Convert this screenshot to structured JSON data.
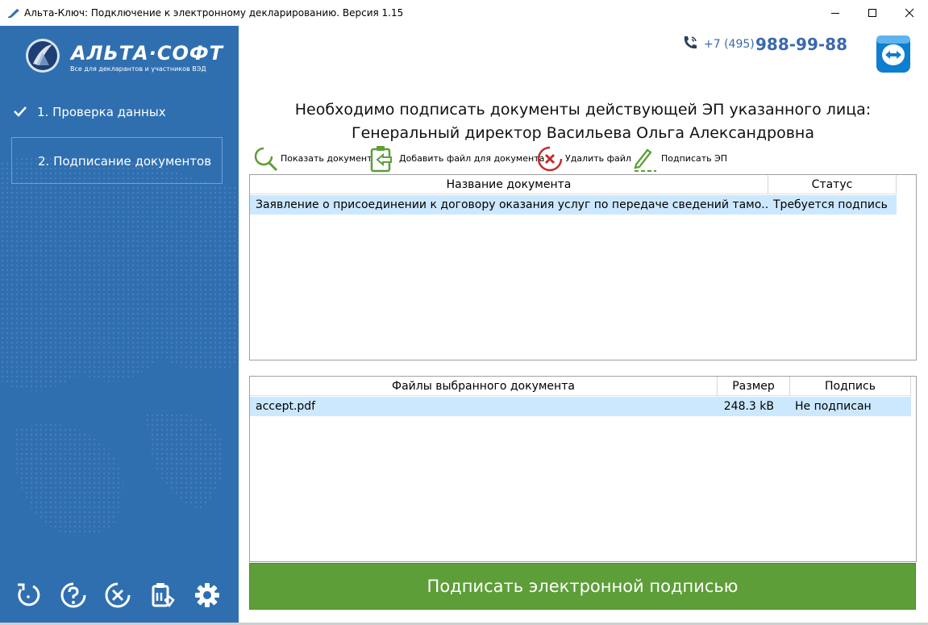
{
  "window": {
    "title": "Альта-Ключ: Подключение к электронному декларированию. Версия 1.15"
  },
  "sidebar": {
    "logo_text": "АЛЬТА·СОФТ",
    "logo_tagline": "Все для декларантов и участников ВЭД",
    "steps": [
      {
        "label": "1. Проверка данных",
        "done": true
      },
      {
        "label": "2. Подписание документов",
        "active": true
      }
    ],
    "bottom_icons": [
      "refresh-icon",
      "help-icon",
      "cancel-icon",
      "clipboard-icon",
      "gear-icon"
    ]
  },
  "contact": {
    "phone_code": "+7 (495)",
    "phone_number": "988-99-88"
  },
  "main": {
    "heading_line1": "Необходимо подписать документы действующей ЭП указанного лица:",
    "heading_line2": "Генеральный директор Васильева Ольга Александровна",
    "toolbar": {
      "show_document": "Показать документ",
      "add_file": "Добавить файл для документа",
      "delete_file": "Удалить файл",
      "sign_ep": "Подписать ЭП"
    },
    "documents_table": {
      "columns": [
        "Название документа",
        "Статус"
      ],
      "rows": [
        {
          "name": "Заявление о присоединении к договору оказания услуг по передаче сведений тамо...",
          "status": "Требуется подпись"
        }
      ]
    },
    "files_table": {
      "columns": [
        "Файлы выбранного документа",
        "Размер",
        "Подпись"
      ],
      "rows": [
        {
          "file": "accept.pdf",
          "size": "248.3 kB",
          "signature": "Не подписан"
        }
      ]
    },
    "sign_button": "Подписать электронной подписью"
  },
  "colors": {
    "sidebar": "#2f6fb0",
    "accent_green": "#5d9e39",
    "phone_blue": "#3a69ad",
    "selection": "#cce8ff"
  }
}
